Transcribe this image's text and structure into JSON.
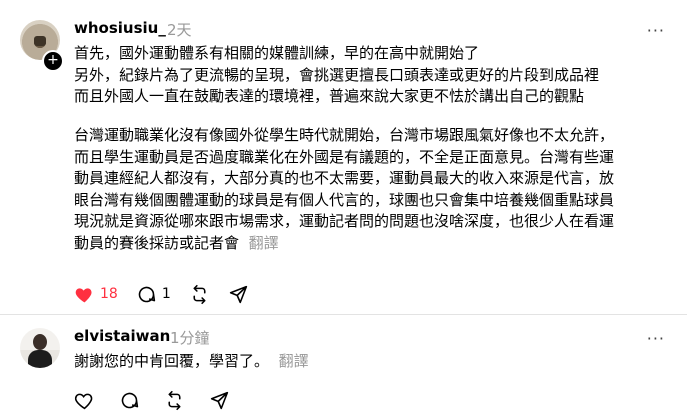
{
  "posts": [
    {
      "username": "whosiusiu_",
      "time": "2天",
      "paragraph1": [
        "首先，國外運動體系有相關的媒體訓練，早的在高中就開始了",
        "另外，紀錄片為了更流暢的呈現，會挑選更擅長口頭表達或更好的片段到成品裡",
        "而且外國人一直在鼓勵表達的環境裡，普遍來說大家更不怯於講出自己的觀點"
      ],
      "paragraph2": [
        "台灣運動職業化沒有像國外從學生時代就開始，台灣市場跟風氣好像也不太允許，",
        "而且學生運動員是否過度職業化在外國是有議題的，不全是正面意見。台灣有些運",
        "動員連經紀人都沒有，大部分真的也不太需要，運動員最大的收入來源是代言，放",
        "眼台灣有幾個團體運動的球員是有個人代言的，球團也只會集中培養幾個重點球員",
        "現況就是資源從哪來跟市場需求，運動記者問的問題也沒啥深度，也很少人在看運",
        "動員的賽後採訪或記者會"
      ],
      "translate_label": "翻譯",
      "likes": "18",
      "comments": "1",
      "liked": true,
      "icons": [
        "heart-icon",
        "comment-icon",
        "repost-icon",
        "share-icon"
      ]
    },
    {
      "username": "elvistaiwan",
      "time": "1分鐘",
      "text": "謝謝您的中肯回覆，學習了。",
      "translate_label": "翻譯",
      "icons": [
        "heart-icon",
        "comment-icon",
        "repost-icon",
        "share-icon"
      ]
    }
  ],
  "more_label": "···",
  "follow_label": "+",
  "colors": {
    "like": "#ff3040",
    "secondary": "#999999",
    "divider": "#e3e3e3"
  }
}
